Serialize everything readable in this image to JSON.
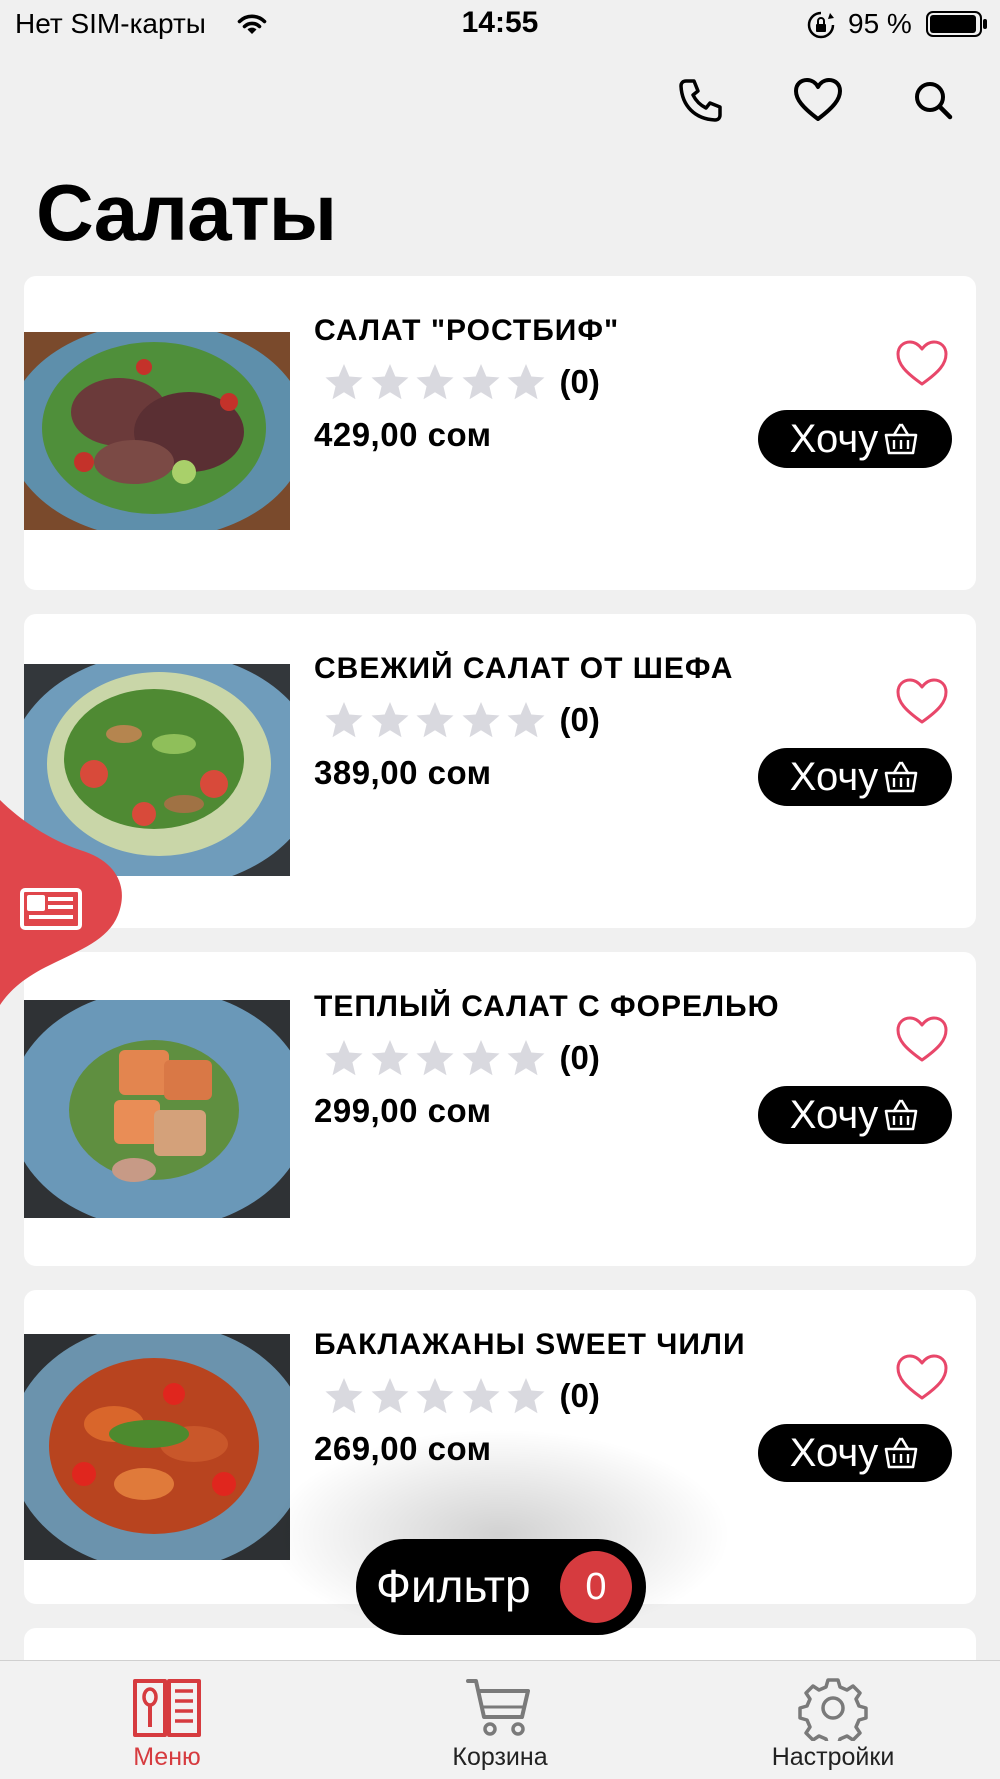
{
  "status_bar": {
    "carrier": "Нет SIM-карты",
    "time": "14:55",
    "battery": "95 %"
  },
  "header": {
    "icons": [
      "phone-icon",
      "heart-icon",
      "search-icon"
    ],
    "title": "Салаты"
  },
  "colors": {
    "accent": "#d63b3f",
    "heart": "#e8476a",
    "background": "#f0f0f0"
  },
  "products": [
    {
      "name": " САЛАТ \"РОСТБИФ\"",
      "rating": 0,
      "rating_count": "(0)",
      "price": "429,00 сом",
      "button": "Хочу"
    },
    {
      "name": "СВЕЖИЙ САЛАТ ОТ ШЕФА",
      "rating": 0,
      "rating_count": "(0)",
      "price": "389,00 сом",
      "button": "Хочу"
    },
    {
      "name": " ТЕПЛЫЙ САЛАТ С ФОРЕЛЬЮ",
      "rating": 0,
      "rating_count": "(0)",
      "price": "299,00 сом",
      "button": "Хочу"
    },
    {
      "name": "БАКЛАЖАНЫ SWEET ЧИЛИ",
      "rating": 0,
      "rating_count": "(0)",
      "price": "269,00 сом",
      "button": "Хочу"
    }
  ],
  "filter": {
    "label": "Фильтр",
    "count": "0"
  },
  "tab_bar": {
    "tabs": [
      {
        "label": "Меню",
        "icon": "menu-book-icon",
        "active": true
      },
      {
        "label": "Корзина",
        "icon": "cart-icon",
        "active": false
      },
      {
        "label": "Настройки",
        "icon": "gear-icon",
        "active": false
      }
    ]
  }
}
